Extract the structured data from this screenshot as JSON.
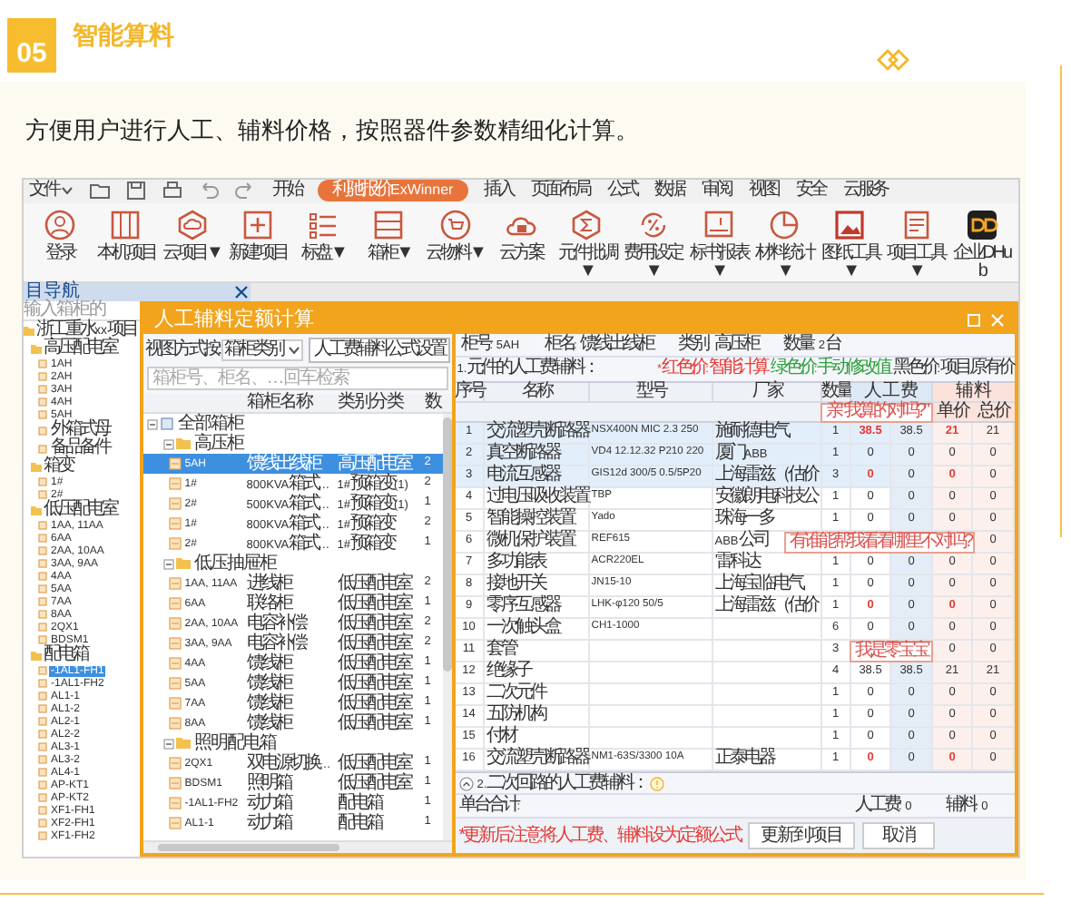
{
  "section": {
    "number": "05",
    "title": "智能算料",
    "description": "方便用户进行人工、辅料价格，按照器件参数精细化计算。"
  },
  "menu": [
    {
      "label": "文件",
      "kind": "dropdown",
      "selected": false
    },
    {
      "label": "开始",
      "kind": "tab",
      "selected": false
    },
    {
      "label": "利驰报价ExWinner",
      "kind": "tab",
      "selected": true
    },
    {
      "label": "插入",
      "kind": "tab",
      "selected": false
    },
    {
      "label": "页面布局",
      "kind": "tab",
      "selected": false
    },
    {
      "label": "公式",
      "kind": "tab",
      "selected": false
    },
    {
      "label": "数据",
      "kind": "tab",
      "selected": false
    },
    {
      "label": "审阅",
      "kind": "tab",
      "selected": false
    },
    {
      "label": "视图",
      "kind": "tab",
      "selected": false
    },
    {
      "label": "安全",
      "kind": "tab",
      "selected": false
    },
    {
      "label": "云服务",
      "kind": "tab",
      "selected": false
    }
  ],
  "toolbar": [
    {
      "label": "登录",
      "kind": "user"
    },
    {
      "label": "本机项目",
      "kind": "columns"
    },
    {
      "label": "云项目▼",
      "kind": "hexcloud"
    },
    {
      "label": "新建项目",
      "kind": "plus"
    },
    {
      "label": "标盘▼",
      "kind": "list"
    },
    {
      "label": "箱柜▼",
      "kind": "drawer"
    },
    {
      "label": "云物料▼",
      "kind": "cart"
    },
    {
      "label": "云方案",
      "kind": "cloud"
    },
    {
      "label": "元件批调▼",
      "kind": "hexzig"
    },
    {
      "label": "费用设定▼",
      "kind": "refresh"
    },
    {
      "label": "标书报表▼",
      "kind": "screen"
    },
    {
      "label": "材料统计▼",
      "kind": "pie"
    },
    {
      "label": "图纸工具▼",
      "kind": "image"
    },
    {
      "label": "项目工具▼",
      "kind": "doc"
    },
    {
      "label": "企业DHub",
      "kind": "logo"
    }
  ],
  "nav": {
    "title": "目导航",
    "search_placeholder": "输入箱柜的",
    "tree": [
      {
        "name": "浙工重水xx项目",
        "expanded": true,
        "children": [
          {
            "name": "高压配电室",
            "expanded": true,
            "children": [
              {
                "name": "1AH",
                "selected": false
              },
              {
                "name": "2AH",
                "selected": false
              },
              {
                "name": "3AH",
                "selected": false
              },
              {
                "name": "4AH",
                "selected": false
              },
              {
                "name": "5AH",
                "selected": false
              },
              {
                "name": "外箱式母",
                "selected": false
              },
              {
                "name": "备品备件",
                "selected": false
              }
            ]
          },
          {
            "name": "箱变",
            "expanded": true,
            "children": [
              {
                "name": "1#",
                "selected": false
              },
              {
                "name": "2#",
                "selected": false
              }
            ]
          },
          {
            "name": "低压配电室",
            "expanded": true,
            "children": [
              {
                "name": "1AA, 11AA",
                "selected": false
              },
              {
                "name": "6AA",
                "selected": false
              },
              {
                "name": "2AA, 10AA",
                "selected": false
              },
              {
                "name": "3AA, 9AA",
                "selected": false
              },
              {
                "name": "4AA",
                "selected": false
              },
              {
                "name": "5AA",
                "selected": false
              },
              {
                "name": "7AA",
                "selected": false
              },
              {
                "name": "8AA",
                "selected": false
              },
              {
                "name": "2QX1",
                "selected": false
              },
              {
                "name": "BDSM1",
                "selected": false
              }
            ]
          },
          {
            "name": "配电箱",
            "expanded": true,
            "children": [
              {
                "name": "-1AL1-FH1",
                "selected": true
              },
              {
                "name": "-1AL1-FH2",
                "selected": false
              },
              {
                "name": "AL1-1",
                "selected": false
              },
              {
                "name": "AL1-2",
                "selected": false
              },
              {
                "name": "AL2-1",
                "selected": false
              },
              {
                "name": "AL2-2",
                "selected": false
              },
              {
                "name": "AL3-1",
                "selected": false
              },
              {
                "name": "AL3-2",
                "selected": false
              },
              {
                "name": "AL4-1",
                "selected": false
              },
              {
                "name": "AP-KT1",
                "selected": false
              },
              {
                "name": "AP-KT2",
                "selected": false
              },
              {
                "name": "XF1-FH1",
                "selected": false
              },
              {
                "name": "XF2-FH1",
                "selected": false
              },
              {
                "name": "XF1-FH2",
                "selected": false
              }
            ]
          }
        ]
      }
    ]
  },
  "dialog": {
    "title": "人工辅料定额计算",
    "view_label": "视图方式按:",
    "view_value": "箱柜类别",
    "formula_button": "人工费辅料公式设置",
    "search_placeholder": "箱柜号、柜名、…回车检索",
    "tree_columns": [
      "箱柜名称",
      "类别分类",
      "数"
    ],
    "tree": [
      {
        "name": "全部箱柜",
        "expanded": true,
        "children": [
          {
            "name": "高压柜",
            "expanded": true,
            "children": [
              {
                "name": "5AH",
                "type": "馈线出线柜",
                "category": "高压配电室",
                "count": "2",
                "selected": true
              },
              {
                "name": "1#",
                "type": "800KVA箱式…",
                "category": "1#预箱变(1)",
                "count": "2",
                "selected": false
              },
              {
                "name": "2#",
                "type": "500KVA箱式…",
                "category": "1#预箱变(1)",
                "count": "1",
                "selected": false
              },
              {
                "name": "1#",
                "type": "800KVA箱式…",
                "category": "1#预箱变",
                "count": "2",
                "selected": false
              },
              {
                "name": "2#",
                "type": "800KVA箱式…",
                "category": "1#预箱变",
                "count": "1",
                "selected": false
              }
            ]
          },
          {
            "name": "低压抽屉柜",
            "expanded": true,
            "children": [
              {
                "name": "1AA, 11AA",
                "type": "进线柜",
                "category": "低压配电室",
                "count": "2",
                "selected": false
              },
              {
                "name": "6AA",
                "type": "联络柜",
                "category": "低压配电室",
                "count": "1",
                "selected": false
              },
              {
                "name": "2AA, 10AA",
                "type": "电容补偿",
                "category": "低压配电室",
                "count": "2",
                "selected": false
              },
              {
                "name": "3AA, 9AA",
                "type": "电容补偿",
                "category": "低压配电室",
                "count": "2",
                "selected": false
              },
              {
                "name": "4AA",
                "type": "馈线柜",
                "category": "低压配电室",
                "count": "1",
                "selected": false
              },
              {
                "name": "5AA",
                "type": "馈线柜",
                "category": "低压配电室",
                "count": "1",
                "selected": false
              },
              {
                "name": "7AA",
                "type": "馈线柜",
                "category": "低压配电室",
                "count": "1",
                "selected": false
              },
              {
                "name": "8AA",
                "type": "馈线柜",
                "category": "低压配电室",
                "count": "1",
                "selected": false
              }
            ]
          },
          {
            "name": "照明配电箱",
            "expanded": true,
            "children": [
              {
                "name": "2QX1",
                "type": "双电源切换…",
                "category": "低压配电室",
                "count": "1",
                "selected": false
              },
              {
                "name": "BDSM1",
                "type": "照明箱",
                "category": "低压配电室",
                "count": "1",
                "selected": false
              },
              {
                "name": "-1AL1-FH2",
                "type": "动力箱",
                "category": "配电箱",
                "count": "1",
                "selected": false
              },
              {
                "name": "AL1-1",
                "type": "动力箱",
                "category": "配电箱",
                "count": "1",
                "selected": false
              }
            ]
          }
        ]
      }
    ],
    "info": [
      {
        "label": "柜号:",
        "value": "5AH"
      },
      {
        "label": "柜名:",
        "value": "馈线出线柜"
      },
      {
        "label": "类别:",
        "value": "高压柜"
      },
      {
        "label": "数量:",
        "value": "2台"
      }
    ],
    "section1": "1.元件的人工费辅料：",
    "legend": [
      {
        "text": "*红色价:智能计算",
        "color": "#e53935"
      },
      {
        "text": "绿色价:手动修改值",
        "color": "#2e9e3e"
      },
      {
        "text": "黑色价:项目原有价",
        "color": "#333333"
      }
    ],
    "columns": [
      "序号",
      "名称",
      "型号",
      "厂家",
      "数量"
    ],
    "labor_group": "人工费",
    "aux_group": "辅料",
    "aux_subcolumns": [
      "单价",
      "总价"
    ],
    "header_callout": "亲\"我算的对吗?\"",
    "rows": [
      {
        "no": "1",
        "name": "交流塑壳断路器",
        "model": "NSX400N MIC 2.3 250",
        "maker": "施耐德电气",
        "qty": "1",
        "labor_unit": "38.5",
        "labor_total": "38.5",
        "aux_unit": "21",
        "aux_total": "21",
        "smart": true,
        "selected": true
      },
      {
        "no": "2",
        "name": "真空断路器",
        "model": "VD4 12.12.32 P210 220",
        "maker": "厦门ABB",
        "qty": "1",
        "labor_unit": "0",
        "labor_total": "0",
        "aux_unit": "0",
        "aux_total": "0",
        "smart": false,
        "selected": true
      },
      {
        "no": "3",
        "name": "电流互感器",
        "model": "GIS12d 300/5 0.5/5P20",
        "maker": "上海雷兹（估价",
        "qty": "3",
        "labor_unit": "0",
        "labor_total": "0",
        "aux_unit": "0",
        "aux_total": "0",
        "smart": true,
        "selected": true
      },
      {
        "no": "4",
        "name": "过电压吸收装置",
        "model": "TBP",
        "maker": "安徽朗电科技公",
        "qty": "1",
        "labor_unit": "0",
        "labor_total": "0",
        "aux_unit": "0",
        "aux_total": "0",
        "smart": false,
        "selected": false
      },
      {
        "no": "5",
        "name": "智能操控装置",
        "model": "Yado",
        "maker": "珠海一多",
        "qty": "1",
        "labor_unit": "0",
        "labor_total": "0",
        "aux_unit": "0",
        "aux_total": "0",
        "smart": false,
        "selected": false
      },
      {
        "no": "6",
        "name": "微机保护装置",
        "model": "REF615",
        "maker": "ABB公司",
        "aux_total": "0",
        "selected": false,
        "callout": "有谁能帮我看看哪里不对吗?"
      },
      {
        "no": "7",
        "name": "多功能表",
        "model": "ACR220EL",
        "maker": "雷科达",
        "qty": "1",
        "labor_unit": "0",
        "labor_total": "0",
        "aux_unit": "0",
        "aux_total": "0",
        "smart": false,
        "selected": false
      },
      {
        "no": "8",
        "name": "接地开关",
        "model": "JN15-10",
        "maker": "上海宝临电气",
        "qty": "1",
        "labor_unit": "0",
        "labor_total": "0",
        "aux_unit": "0",
        "aux_total": "0",
        "smart": false,
        "selected": false
      },
      {
        "no": "9",
        "name": "零序互感器",
        "model": "LHK-φ120 50/5",
        "maker": "上海雷兹（估价",
        "qty": "1",
        "labor_unit": "0",
        "labor_total": "0",
        "aux_unit": "0",
        "aux_total": "0",
        "smart": true,
        "selected": false
      },
      {
        "no": "10",
        "name": "一次触头盒",
        "model": "CH1-1000",
        "qty": "6",
        "labor_unit": "0",
        "labor_total": "0",
        "aux_unit": "0",
        "aux_total": "0",
        "smart": false,
        "selected": false
      },
      {
        "no": "11",
        "name": "套管",
        "qty": "3",
        "aux_unit": "0",
        "aux_total": "0",
        "smart": false,
        "selected": false,
        "callout": "我是零宝宝"
      },
      {
        "no": "12",
        "name": "绝缘子",
        "qty": "4",
        "labor_unit": "38.5",
        "labor_total": "38.5",
        "aux_unit": "21",
        "aux_total": "21",
        "smart": false,
        "selected": false
      },
      {
        "no": "13",
        "name": "二次元件",
        "qty": "1",
        "labor_unit": "0",
        "labor_total": "0",
        "aux_unit": "0",
        "aux_total": "0",
        "smart": false,
        "selected": false
      },
      {
        "no": "14",
        "name": "五防机构",
        "qty": "1",
        "labor_unit": "0",
        "labor_total": "0",
        "aux_unit": "0",
        "aux_total": "0",
        "smart": false,
        "selected": false
      },
      {
        "no": "15",
        "name": "付材",
        "qty": "1",
        "labor_unit": "0",
        "labor_total": "0",
        "aux_unit": "0",
        "aux_total": "0",
        "smart": false,
        "selected": false
      },
      {
        "no": "16",
        "name": "交流塑壳断路器",
        "model": "NM1-63S/3300 10A",
        "maker": "正泰电器",
        "qty": "1",
        "labor_unit": "0",
        "labor_total": "0",
        "aux_unit": "0",
        "aux_total": "0",
        "smart": true,
        "selected": false
      }
    ],
    "section2": "2.二次回路的人工费辅料：",
    "totals": {
      "label": "单台合计:",
      "labor_label": "人工费:",
      "labor": "0",
      "aux_label": "辅料:",
      "aux": "0"
    },
    "note": "*更新后注意将人工费、辅料设为定额公式",
    "buttons": [
      "更新到项目",
      "取消"
    ]
  }
}
